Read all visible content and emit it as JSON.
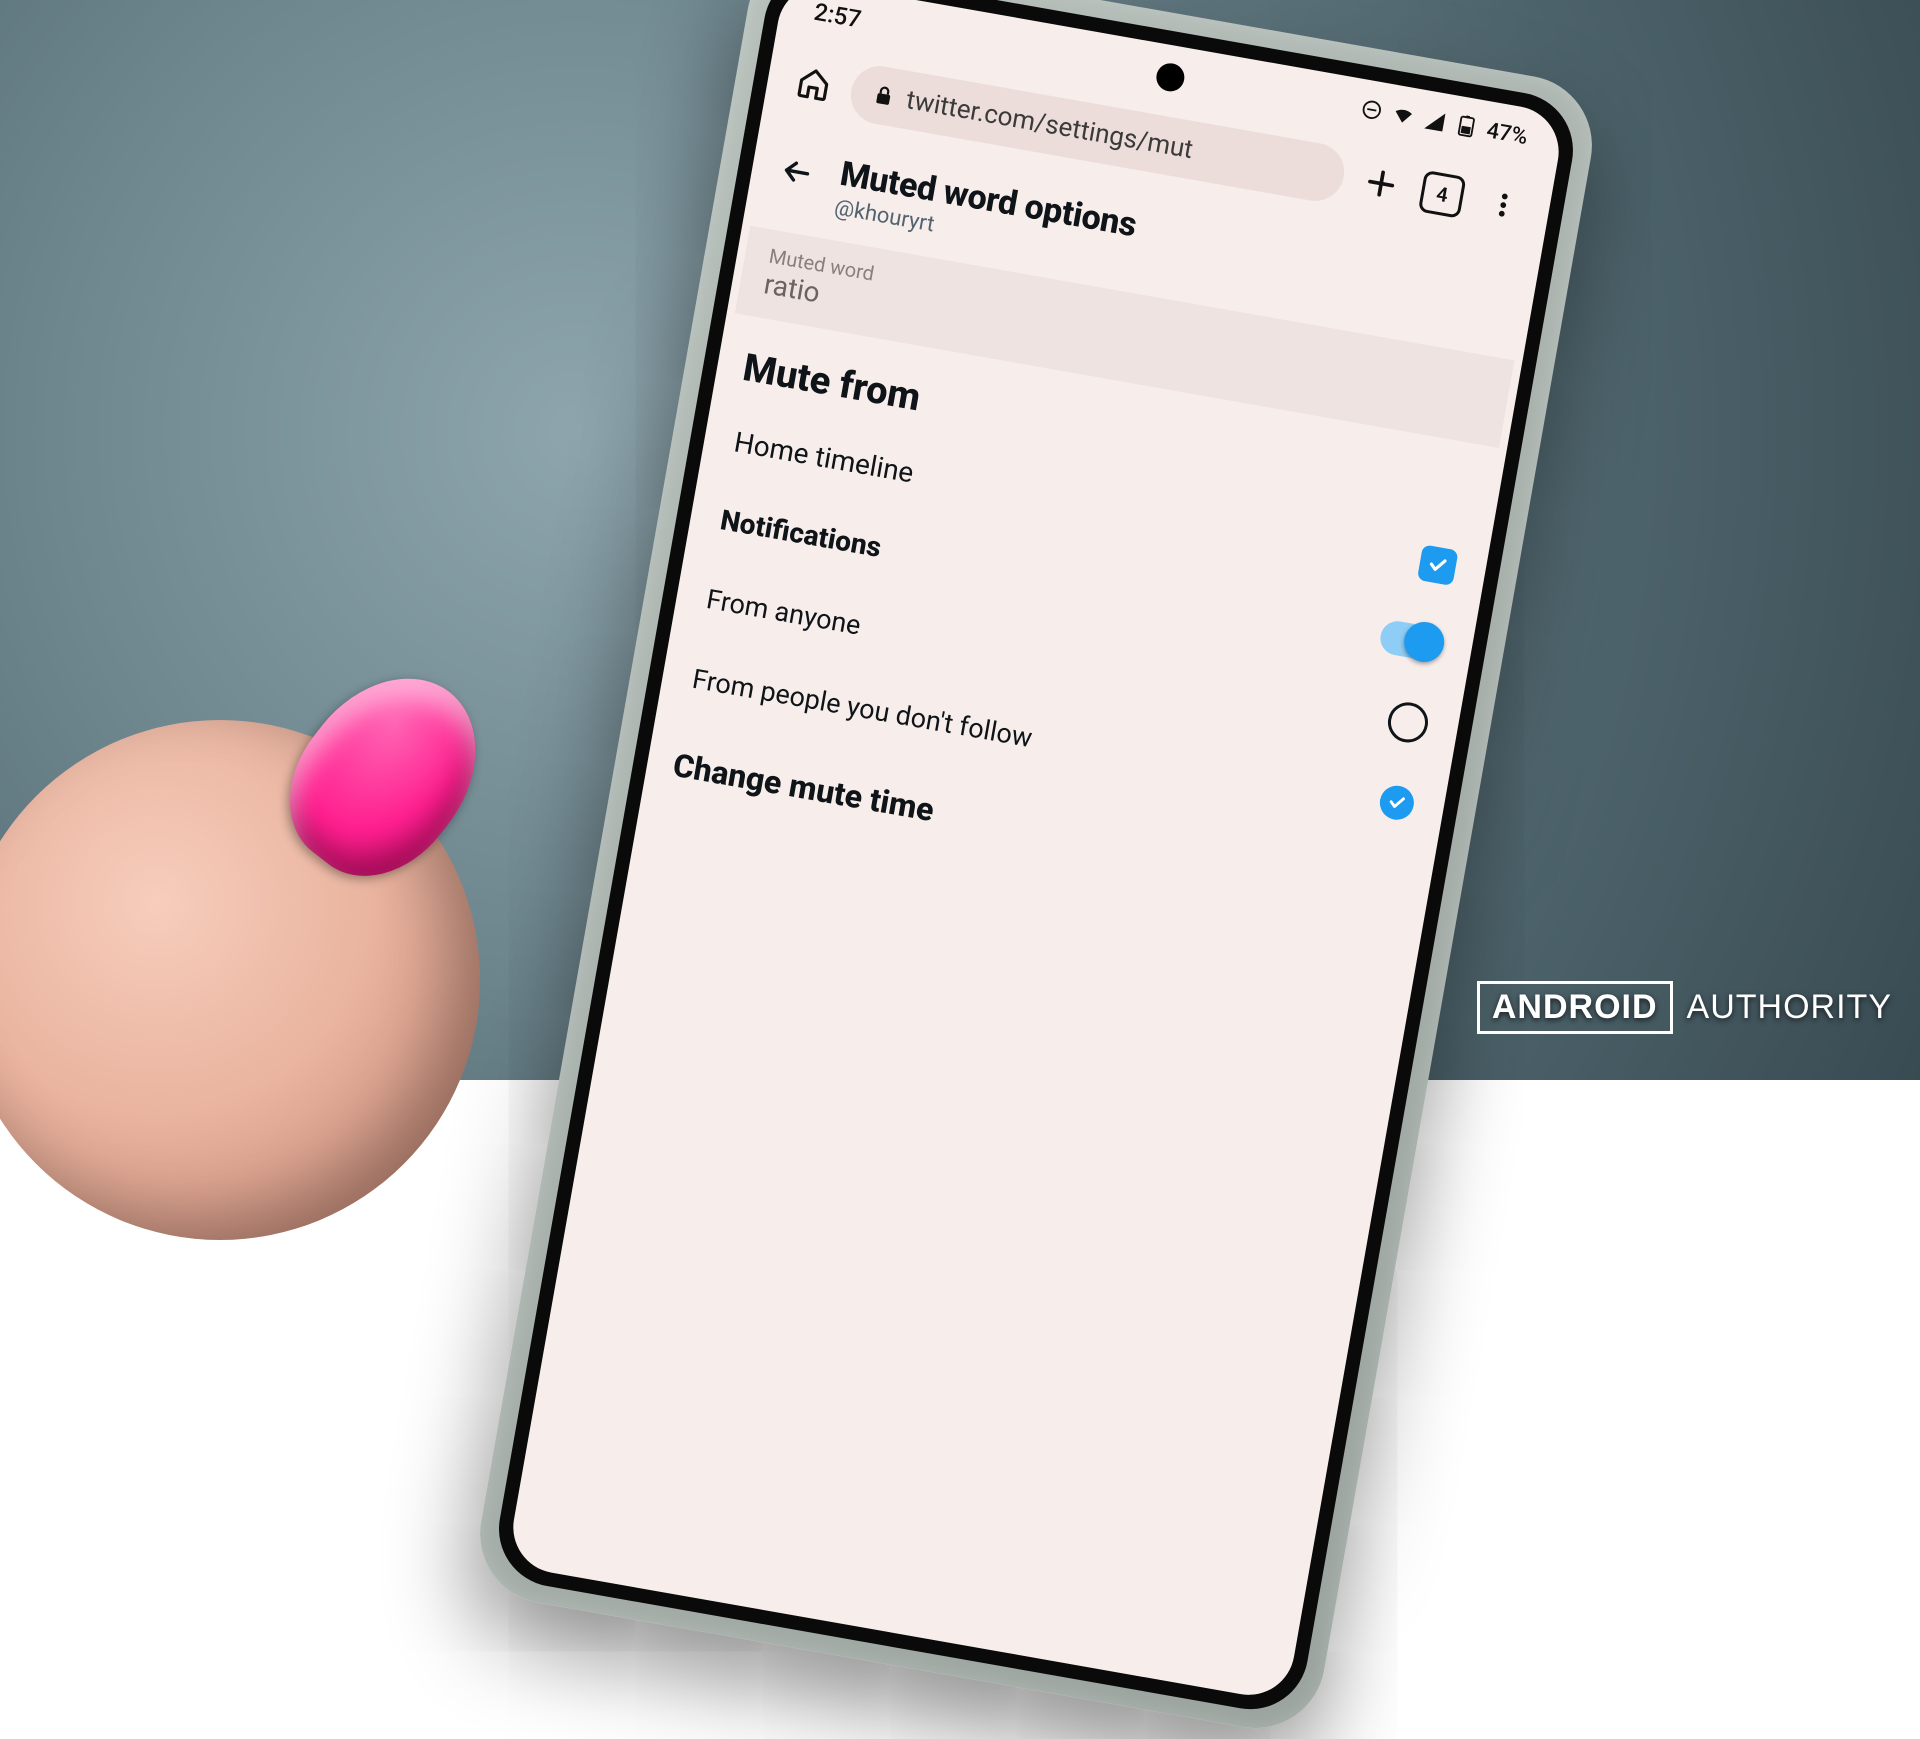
{
  "status": {
    "time": "2:57",
    "battery_pct": "47%"
  },
  "browser": {
    "url_display": "twitter.com/settings/mut",
    "tab_count": "4"
  },
  "header": {
    "title": "Muted word options",
    "handle": "@khouryrt"
  },
  "input": {
    "label": "Muted word",
    "value": "ratio"
  },
  "sections": {
    "mute_from": {
      "heading": "Mute from",
      "home_timeline": "Home timeline"
    },
    "notifications": {
      "heading": "Notifications",
      "from_anyone": "From anyone",
      "from_nonfollow": "From people you don't follow"
    },
    "change_time": {
      "heading": "Change mute time"
    }
  },
  "watermark": {
    "brand_left": "ANDROID",
    "brand_right": "AUTHORITY"
  },
  "colors": {
    "accent": "#1d9bf0",
    "screen_bg": "#f7eeec"
  }
}
